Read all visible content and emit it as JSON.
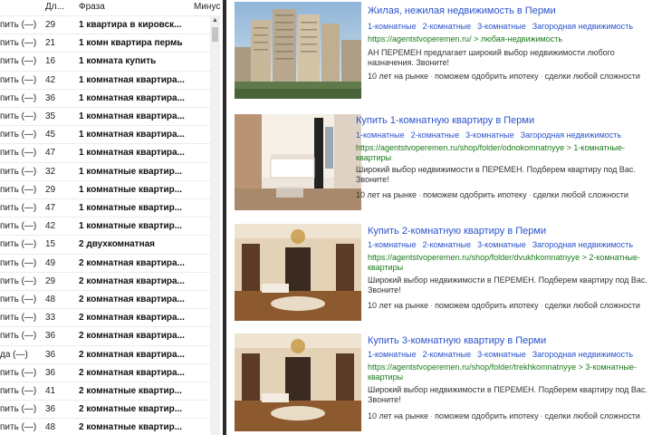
{
  "table": {
    "headers": {
      "len": "Дл...",
      "phrase": "Фраза",
      "minus": "Минус"
    },
    "rows": [
      {
        "prefix": "пить (—)",
        "len": "29",
        "phrase": "1 квартира в кировск..."
      },
      {
        "prefix": "пить (—)",
        "len": "21",
        "phrase": "1 комн квартира пермь"
      },
      {
        "prefix": "пить (—)",
        "len": "16",
        "phrase": "1 комната купить"
      },
      {
        "prefix": "пить (—)",
        "len": "42",
        "phrase": "1 комнатная квартира..."
      },
      {
        "prefix": "пить (—)",
        "len": "36",
        "phrase": "1 комнатная квартира..."
      },
      {
        "prefix": "пить (—)",
        "len": "35",
        "phrase": "1 комнатная квартира..."
      },
      {
        "prefix": "пить (—)",
        "len": "45",
        "phrase": "1 комнатная квартира..."
      },
      {
        "prefix": "пить (—)",
        "len": "47",
        "phrase": "1 комнатная квартира..."
      },
      {
        "prefix": "пить (—)",
        "len": "32",
        "phrase": "1 комнатные квартир..."
      },
      {
        "prefix": "пить (—)",
        "len": "29",
        "phrase": "1 комнатные квартир..."
      },
      {
        "prefix": "пить (—)",
        "len": "47",
        "phrase": "1 комнатные квартир..."
      },
      {
        "prefix": "пить (—)",
        "len": "42",
        "phrase": "1 комнатные квартир..."
      },
      {
        "prefix": "пить (—)",
        "len": "15",
        "phrase": "2 двухкомнатная"
      },
      {
        "prefix": "пить (—)",
        "len": "49",
        "phrase": "2 комнатная квартира..."
      },
      {
        "prefix": "пить (—)",
        "len": "29",
        "phrase": "2 комнатная квартира..."
      },
      {
        "prefix": "пить (—)",
        "len": "48",
        "phrase": "2 комнатная квартира..."
      },
      {
        "prefix": "пить (—)",
        "len": "33",
        "phrase": "2 комнатная квартира..."
      },
      {
        "prefix": "пить (—)",
        "len": "36",
        "phrase": "2 комнатная квартира..."
      },
      {
        "prefix": "да (—)",
        "len": "36",
        "phrase": "2 комнатная квартира..."
      },
      {
        "prefix": "пить (—)",
        "len": "36",
        "phrase": "2 комнатная квартира..."
      },
      {
        "prefix": "пить (—)",
        "len": "41",
        "phrase": "2 комнатные квартир..."
      },
      {
        "prefix": "пить (—)",
        "len": "36",
        "phrase": "2 комнатные квартир..."
      },
      {
        "prefix": "пить (—)",
        "len": "48",
        "phrase": "2 комнатные квартир..."
      }
    ]
  },
  "ads": [
    {
      "title": "Жилая, нежилая недвижимость в Перми",
      "links": [
        "1-комнатные",
        "2-комнатные",
        "3-комнатные",
        "Загородная недвижимость"
      ],
      "url": "https://agentstvoperemen.ru/ > любая-недвижимость",
      "desc": "АН ПЕРЕМЕН предлагает широкий выбор недвижимости любого назначения. Звоните!",
      "features": [
        "10 лет на рынке",
        "поможем одобрить ипотеку",
        "сделки любой сложности"
      ],
      "image": "building-photo"
    },
    {
      "title": "Купить 1-комнатную квартиру в Перми",
      "links": [
        "1-комнатные",
        "2-комнатные",
        "3-комнатные",
        "Загородная недвижимость"
      ],
      "url": "https://agentstvoperemen.ru/shop/folder/odnokomnatnyye > 1-комнатные-квартиры",
      "desc": "Широкий выбор недвижимости в ПЕРЕМЕН. Подберем квартиру под Вас. Звоните!",
      "features": [
        "10 лет на рынке",
        "поможем одобрить ипотеку",
        "сделки любой сложности"
      ],
      "image": "room-photo"
    },
    {
      "title": "Купить 2-комнатную квартиру в Перми",
      "links": [
        "1-комнатные",
        "2-комнатные",
        "3-комнатные",
        "Загородная недвижимость"
      ],
      "url": "https://agentstvoperemen.ru/shop/folder/dvukhkomnatnyye > 2-комнатные-квартиры",
      "desc": "Широкий выбор недвижимости в ПЕРЕМЕН. Подберем квартиру под Вас. Звоните!",
      "features": [
        "10 лет на рынке",
        "поможем одобрить ипотеку",
        "сделки любой сложности"
      ],
      "image": "living-room-photo"
    },
    {
      "title": "Купить 3-комнатную квартиру в Перми",
      "links": [
        "1-комнатные",
        "2-комнатные",
        "3-комнатные",
        "Загородная недвижимость"
      ],
      "url": "https://agentstvoperemen.ru/shop/folder/trekhkomnatnyye > 3-комнатные-квартиры",
      "desc": "Широкий выбор недвижимости в ПЕРЕМЕН. Подберем квартиру под Вас. Звоните!",
      "features": [
        "10 лет на рынке",
        "поможем одобрить ипотеку",
        "сделки любой сложности"
      ],
      "image": "living-room-photo"
    }
  ]
}
